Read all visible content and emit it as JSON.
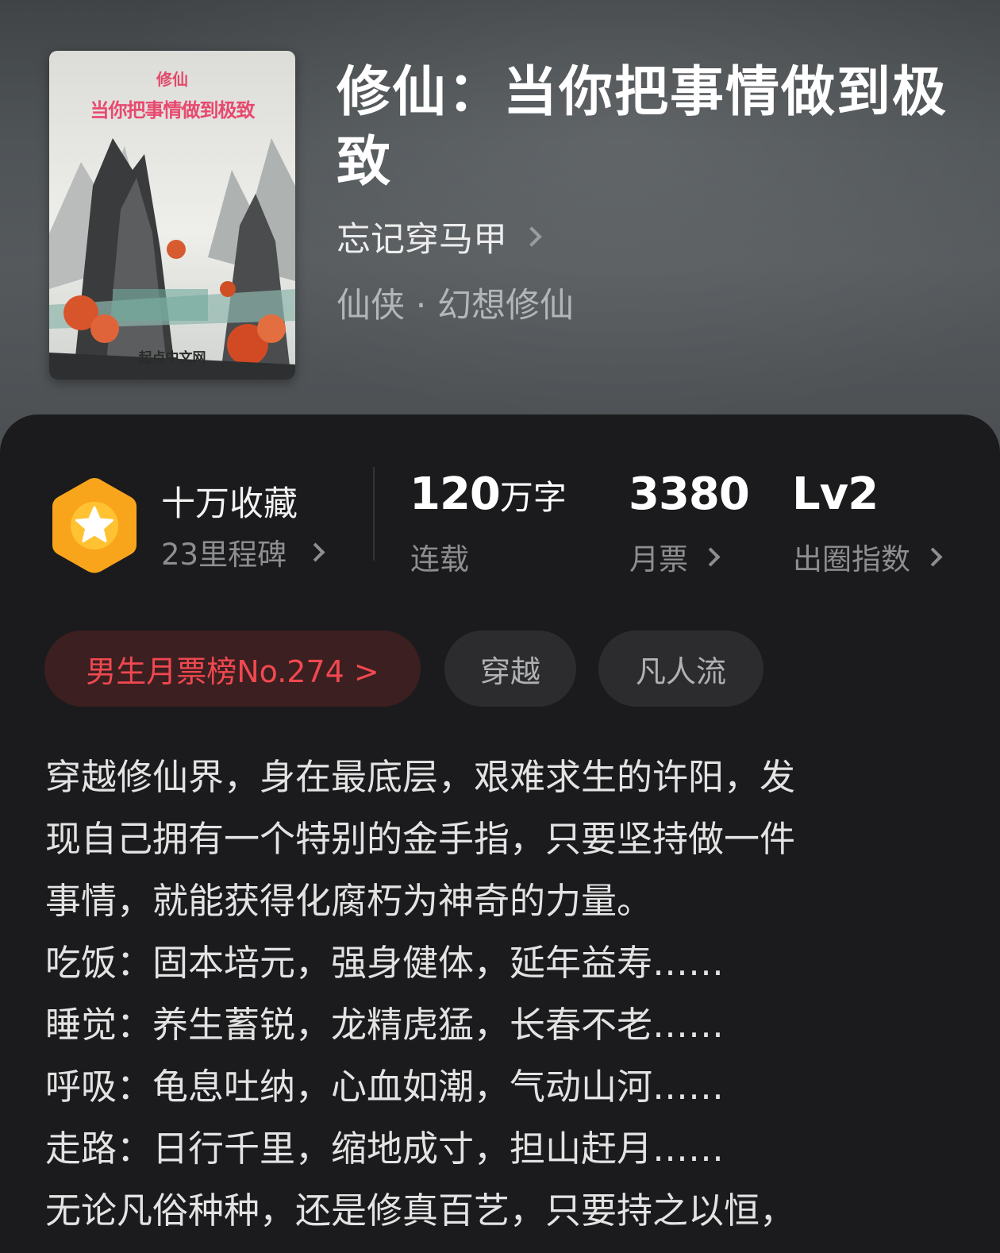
{
  "book": {
    "title": "修仙：当你把事情做到极致",
    "author": "忘记穿马甲",
    "genre": "仙侠 · 幻想修仙",
    "cover": {
      "small_title": "修仙",
      "main_title": "当你把事情做到极致",
      "publisher": "起点中文网"
    }
  },
  "stats": {
    "collect_title": "十万收藏",
    "milestone": "23里程碑",
    "words_value": "120",
    "words_unit": "万字",
    "words_label": "连载",
    "monthly_votes_value": "3380",
    "monthly_votes_label": "月票",
    "level_value": "Lv2",
    "level_label": "出圈指数"
  },
  "tags": {
    "rank": "男生月票榜No.274 >",
    "tag1": "穿越",
    "tag2": "凡人流"
  },
  "description": [
    "穿越修仙界，身在最底层，艰难求生的许阳，发",
    "现自己拥有一个特别的金手指，只要坚持做一件",
    "事情，就能获得化腐朽为神奇的力量。",
    "吃饭：固本培元，强身健体，延年益寿……",
    "睡觉：养生蓄锐，龙精虎猛，长春不老……",
    "呼吸：龟息吐纳，心血如潮，气动山河……",
    "走路：日行千里，缩地成寸，担山赶月……",
    "无论凡俗种种，还是修真百艺，只要持之以恒，"
  ],
  "colors": {
    "accent_red": "#f0484f",
    "badge_gold": "#f9a51b",
    "background": "#1b1b1d"
  },
  "icons": {
    "badge": "star-hexagon-icon",
    "chevron": "chevron-right-icon"
  }
}
